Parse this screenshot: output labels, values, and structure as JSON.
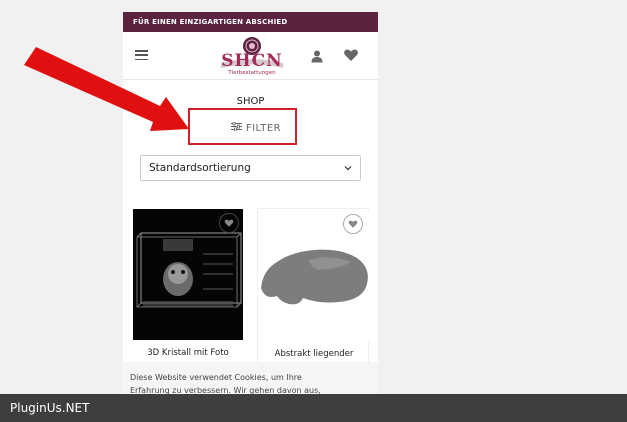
{
  "topbar": {
    "text": "FÜR EINEN EINZIGARTIGEN ABSCHIED"
  },
  "header": {
    "logo_text": "SHCN",
    "logo_sub": "Tierbestattungen"
  },
  "page": {
    "title": "SHOP"
  },
  "filter": {
    "label": "FILTER"
  },
  "sort": {
    "value": "Standardsortierung"
  },
  "products": [
    {
      "title": "3D Kristall mit Foto"
    },
    {
      "title": "Abstrakt liegender"
    }
  ],
  "cookie": {
    "line1": "Diese Website verwendet Cookies, um Ihre",
    "line2": "Erfahrung zu verbessern. Wir gehen davon aus,"
  },
  "footer": {
    "brand": "PluginUs.NET"
  },
  "colors": {
    "topbar_bg": "#5b2340",
    "brand": "#a32b57",
    "highlight": "#cf1f2a",
    "arrow": "#e01010",
    "footer_bg": "#3e3e3e"
  },
  "icons": [
    "menu-icon",
    "user-icon",
    "heart-icon",
    "sliders-icon",
    "chevron-down-icon"
  ]
}
